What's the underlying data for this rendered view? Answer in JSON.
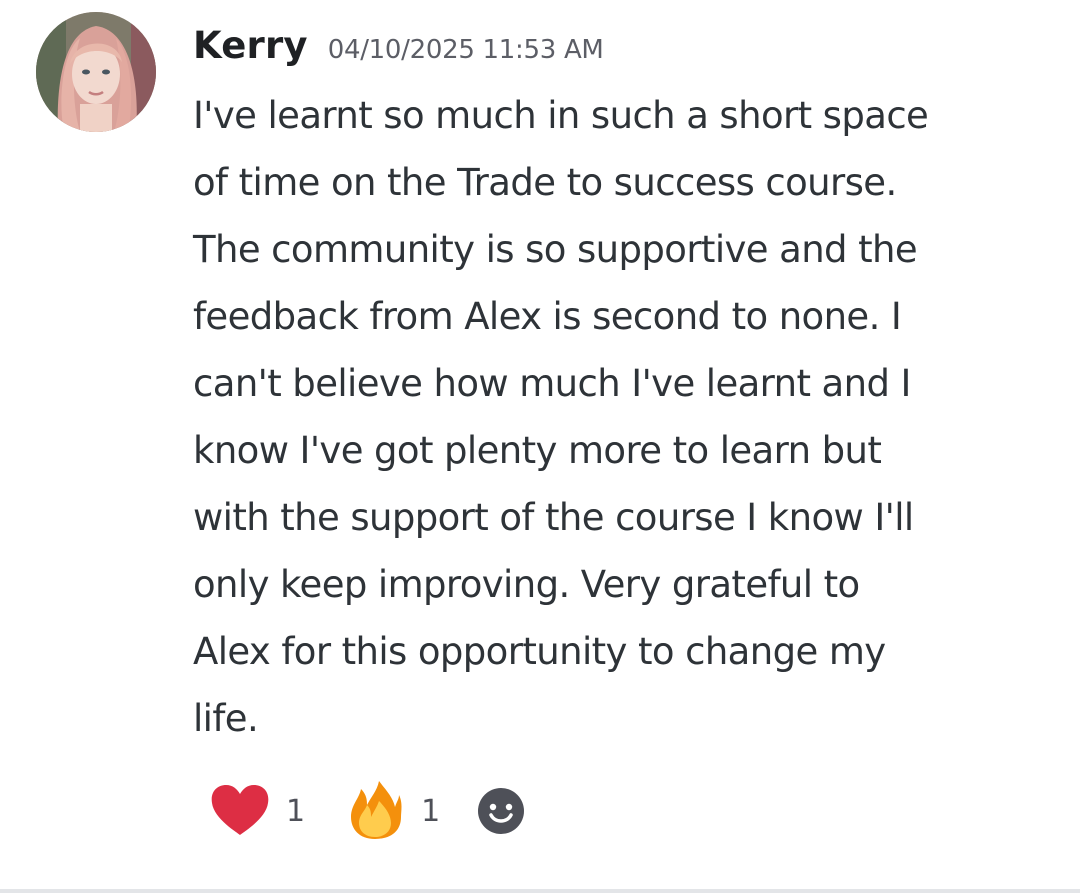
{
  "message": {
    "author": "Kerry",
    "timestamp": "04/10/2025 11:53 AM",
    "avatar_icon": "user-avatar",
    "lines": [
      "I've learnt so much in such a short space",
      "of time on the Trade to success course.",
      "The community is so supportive and the",
      "feedback from Alex is second to none. I",
      "can't believe how much I've learnt and I",
      "know I've got plenty more to learn but",
      "with the support of the course I know I'll",
      "only keep improving. Very grateful to",
      "Alex for this opportunity to change my",
      "life."
    ]
  },
  "reactions": [
    {
      "icon": "heart-icon",
      "count": "1",
      "color": "#dd2e44"
    },
    {
      "icon": "fire-icon",
      "count": "1",
      "color": "#f4900c"
    }
  ],
  "add_reaction": {
    "icon": "smiley-icon",
    "color": "#4e5058"
  }
}
